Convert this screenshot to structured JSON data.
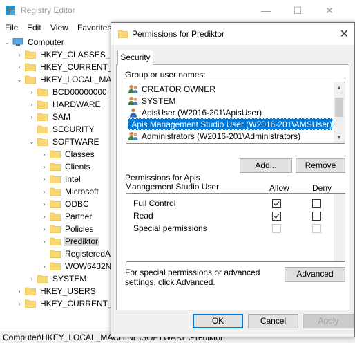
{
  "registry_editor": {
    "title": "Registry Editor",
    "controls": {
      "minimize": "—",
      "maximize": "☐",
      "close": "✕"
    },
    "menu": [
      "File",
      "Edit",
      "View",
      "Favorites"
    ],
    "tree": [
      {
        "label": "Computer",
        "expander": "⌄",
        "icon": "computer-icon"
      },
      {
        "label": "HKEY_CLASSES_RO",
        "expander": "›",
        "icon": "folder-icon"
      },
      {
        "label": "HKEY_CURRENT_U",
        "expander": "›",
        "icon": "folder-icon"
      },
      {
        "label": "HKEY_LOCAL_MA",
        "expander": "⌄",
        "icon": "folder-icon"
      },
      {
        "label": "BCD00000000",
        "expander": "›",
        "icon": "folder-icon"
      },
      {
        "label": "HARDWARE",
        "expander": "›",
        "icon": "folder-icon"
      },
      {
        "label": "SAM",
        "expander": "›",
        "icon": "folder-icon"
      },
      {
        "label": "SECURITY",
        "expander": "",
        "icon": "folder-icon"
      },
      {
        "label": "SOFTWARE",
        "expander": "⌄",
        "icon": "folder-icon"
      },
      {
        "label": "Classes",
        "expander": "›",
        "icon": "folder-icon"
      },
      {
        "label": "Clients",
        "expander": "›",
        "icon": "folder-icon"
      },
      {
        "label": "Intel",
        "expander": "›",
        "icon": "folder-icon"
      },
      {
        "label": "Microsoft",
        "expander": "›",
        "icon": "folder-icon"
      },
      {
        "label": "ODBC",
        "expander": "›",
        "icon": "folder-icon"
      },
      {
        "label": "Partner",
        "expander": "›",
        "icon": "folder-icon"
      },
      {
        "label": "Policies",
        "expander": "›",
        "icon": "folder-icon"
      },
      {
        "label": "Prediktor",
        "expander": "›",
        "icon": "folder-icon",
        "selected": true
      },
      {
        "label": "RegisteredA",
        "expander": "",
        "icon": "folder-icon"
      },
      {
        "label": "WOW6432N",
        "expander": "›",
        "icon": "folder-icon"
      },
      {
        "label": "SYSTEM",
        "expander": "›",
        "icon": "folder-icon"
      },
      {
        "label": "HKEY_USERS",
        "expander": "›",
        "icon": "folder-icon"
      },
      {
        "label": "HKEY_CURRENT_C",
        "expander": "›",
        "icon": "folder-icon"
      }
    ],
    "status_path": "Computer\\HKEY_LOCAL_MACHINE\\SOFTWARE\\Prediktor"
  },
  "dialog": {
    "title": "Permissions for Prediktor",
    "close": "✕",
    "tab": "Security",
    "group_label": "Group or user names:",
    "users": [
      {
        "name": "CREATOR OWNER",
        "icon": "group-icon"
      },
      {
        "name": "SYSTEM",
        "icon": "group-icon"
      },
      {
        "name": "ApisUser (W2016-201\\ApisUser)",
        "icon": "user-icon"
      },
      {
        "name": "Apis Management Studio User (W2016-201\\AMSUser)",
        "icon": "user-icon",
        "selected": true
      },
      {
        "name": "Administrators (W2016-201\\Administrators)",
        "icon": "group-icon"
      }
    ],
    "add_button": "Add...",
    "remove_button": "Remove",
    "permissions_label": "Permissions for Apis Management Studio User",
    "allow_header": "Allow",
    "deny_header": "Deny",
    "permissions": [
      {
        "name": "Full Control",
        "allow": true,
        "deny": false,
        "enabled": true
      },
      {
        "name": "Read",
        "allow": true,
        "deny": false,
        "enabled": true
      },
      {
        "name": "Special permissions",
        "allow": false,
        "deny": false,
        "enabled": false
      }
    ],
    "advanced_text": "For special permissions or advanced settings, click Advanced.",
    "advanced_button": "Advanced",
    "ok_button": "OK",
    "cancel_button": "Cancel",
    "apply_button": "Apply"
  },
  "colors": {
    "selection": "#0078d7",
    "folder": "#f8d775",
    "dialog_bg": "#f0f0f0"
  }
}
